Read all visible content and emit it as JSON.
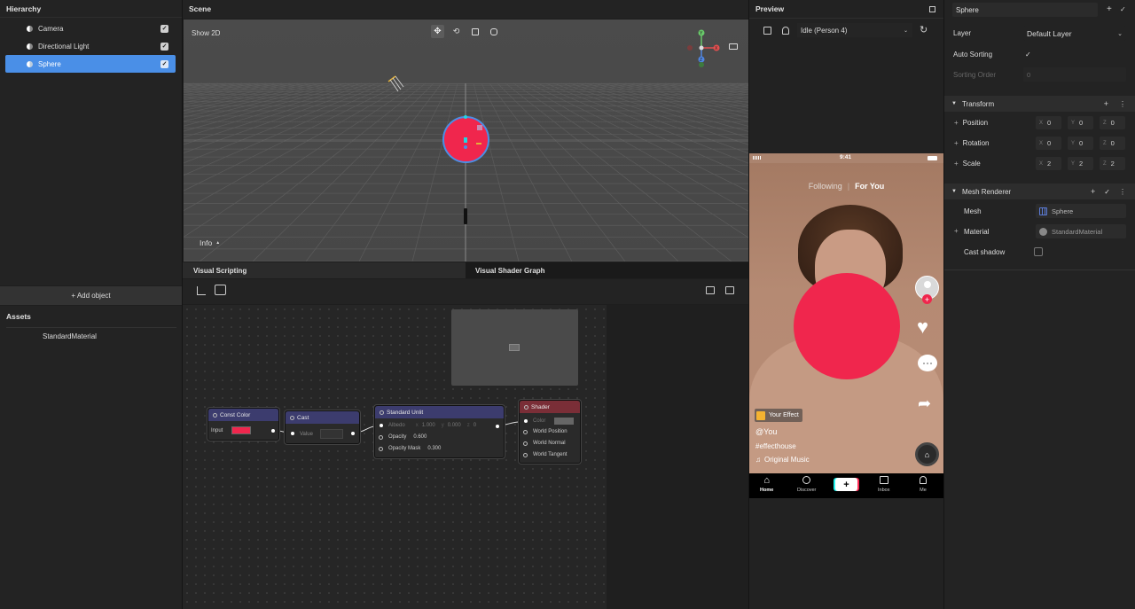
{
  "hierarchy": {
    "title": "Hierarchy",
    "items": [
      {
        "label": "Camera",
        "checked": true,
        "selected": false
      },
      {
        "label": "Directional Light",
        "checked": true,
        "selected": false
      },
      {
        "label": "Sphere",
        "checked": true,
        "selected": true
      }
    ],
    "add_object": "+ Add object"
  },
  "assets": {
    "title": "Assets",
    "items": [
      "StandardMaterial"
    ]
  },
  "scene": {
    "title": "Scene",
    "show_2d": "Show 2D",
    "info": "Info",
    "gizmo_y": "Y",
    "gizmo_x": "X",
    "gizmo_z": "Z"
  },
  "tabs": {
    "visual_scripting": "Visual Scripting",
    "visual_shader_graph": "Visual Shader Graph"
  },
  "nodes": {
    "const_color": {
      "title": "Const Color",
      "input": "Input",
      "color": "#f0264d"
    },
    "cast": {
      "title": "Cast",
      "value": "Value"
    },
    "standard_unlit": {
      "title": "Standard Unlit",
      "albedo": "Albedo",
      "x": "x",
      "x_val": "1.000",
      "y": "y",
      "y_val": "0.000",
      "z": "z",
      "z_val": "0",
      "opacity": "Opacity",
      "opacity_val": "0.600",
      "opacity_mask": "Opacity Mask",
      "opacity_mask_val": "0.300"
    },
    "shader": {
      "title": "Shader",
      "color": "Color",
      "world_position": "World Position",
      "world_normal": "World Normal",
      "world_tangent": "World Tangent"
    }
  },
  "preview": {
    "title": "Preview",
    "animation": "Idle (Person 4)",
    "status_time": "9:41",
    "feed_following": "Following",
    "feed_separator": "|",
    "feed_for_you": "For You",
    "your_effect": "Your Effect",
    "username": "@You",
    "hashtag": "#effecthouse",
    "music": "Original Music",
    "nav": [
      "Home",
      "Discover",
      "",
      "Inbox",
      "Me"
    ]
  },
  "inspector": {
    "name_value": "Sphere",
    "layer_label": "Layer",
    "layer_value": "Default Layer",
    "auto_sorting": "Auto Sorting",
    "sorting_order": "Sorting Order",
    "sorting_order_value": "0",
    "transform": {
      "title": "Transform",
      "rows": [
        {
          "label": "Position",
          "x": "0",
          "y": "0",
          "z": "0"
        },
        {
          "label": "Rotation",
          "x": "0",
          "y": "0",
          "z": "0"
        },
        {
          "label": "Scale",
          "x": "2",
          "y": "2",
          "z": "2"
        }
      ],
      "axis_x": "X",
      "axis_y": "Y",
      "axis_z": "Z"
    },
    "mesh_renderer": {
      "title": "Mesh Renderer",
      "mesh_label": "Mesh",
      "mesh_value": "Sphere",
      "material_label": "Material",
      "material_value": "StandardMaterial",
      "cast_shadow": "Cast shadow"
    }
  },
  "colors": {
    "accent": "#4a8fe7",
    "sphere": "#f0264d",
    "scene_bg": "#4a4a4a",
    "panel": "#232323"
  }
}
